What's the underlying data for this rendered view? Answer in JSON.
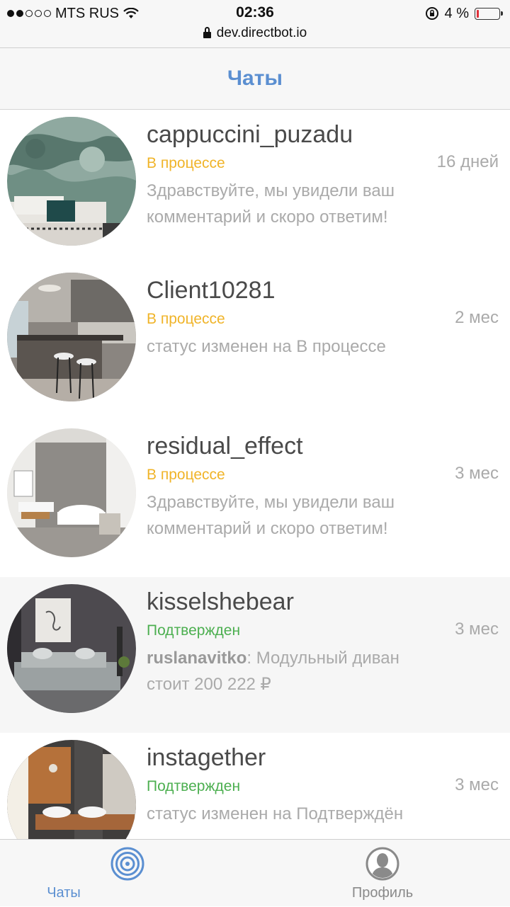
{
  "status_bar": {
    "carrier": "MTS RUS",
    "time": "02:36",
    "battery": "4 %",
    "battery_level": 0.04,
    "url": "dev.directbot.io"
  },
  "nav": {
    "title": "Чаты"
  },
  "colors": {
    "accent": "#5b8fd1",
    "in_progress": "#f0b429",
    "confirmed": "#4caf50",
    "muted": "#aaaaaa"
  },
  "chats": [
    {
      "name": "cappuccini_puzadu",
      "status": "В процессе",
      "time": "16 дней",
      "preview": "Здравствуйте, мы увидели ваш комментарий и скоро ответим!"
    },
    {
      "name": "Client10281",
      "status": "В процессе",
      "time": "2 мес",
      "preview": "статус изменен на В процессе"
    },
    {
      "name": "residual_effect",
      "status": "В процессе",
      "time": "3 мес",
      "preview": "Здравствуйте, мы увидели ваш комментарий и скоро ответим!"
    },
    {
      "name": "kisselshebear",
      "status": "Подтвержден",
      "time": "3 мес",
      "preview_author": "ruslanavitko",
      "preview": ": Модульный диван стоит 200 222 ₽"
    },
    {
      "name": "instagether",
      "status": "Подтвержден",
      "time": "3 мес",
      "preview": "статус изменен на Подтверждён"
    }
  ],
  "tabbar": {
    "chats_label": "Чаты",
    "profile_label": "Профиль"
  }
}
